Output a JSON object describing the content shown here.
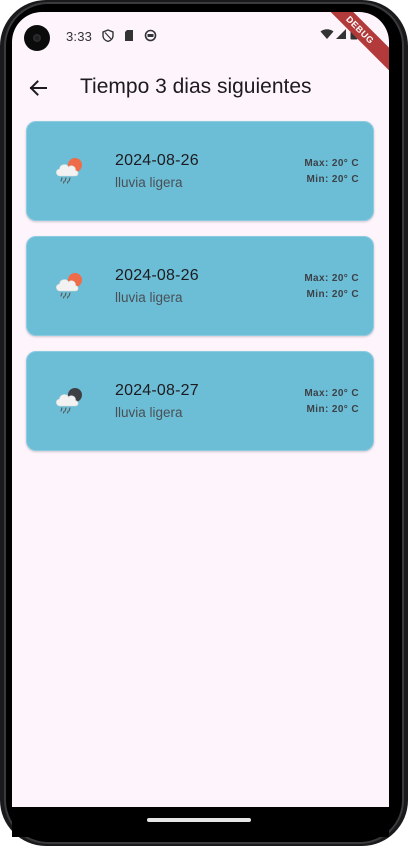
{
  "status_bar": {
    "time": "3:33",
    "icons": [
      "shield-icon",
      "sim-card-icon",
      "sync-icon",
      "wifi-icon",
      "signal-icon",
      "battery-icon"
    ],
    "debug_label": "DEBUG"
  },
  "app_bar": {
    "back_icon": "arrow-left-icon",
    "title": "Tiempo 3 dias siguientes"
  },
  "forecast": [
    {
      "date": "2024-08-26",
      "description": "lluvia ligera",
      "max": "Max: 20° C",
      "min": "Min: 20° C",
      "icon": "rain-cloud-sun-icon",
      "icon_accent": "#ef6c4a"
    },
    {
      "date": "2024-08-26",
      "description": "lluvia ligera",
      "max": "Max: 20° C",
      "min": "Min: 20° C",
      "icon": "rain-cloud-sun-icon",
      "icon_accent": "#ef6c4a"
    },
    {
      "date": "2024-08-27",
      "description": "lluvia ligera",
      "max": "Max: 20° C",
      "min": "Min: 20° C",
      "icon": "rain-cloud-moon-icon",
      "icon_accent": "#3f4046"
    }
  ],
  "colors": {
    "background": "#fdf4fc",
    "card": "#6cbed6",
    "debug_banner": "#b33a3a"
  }
}
